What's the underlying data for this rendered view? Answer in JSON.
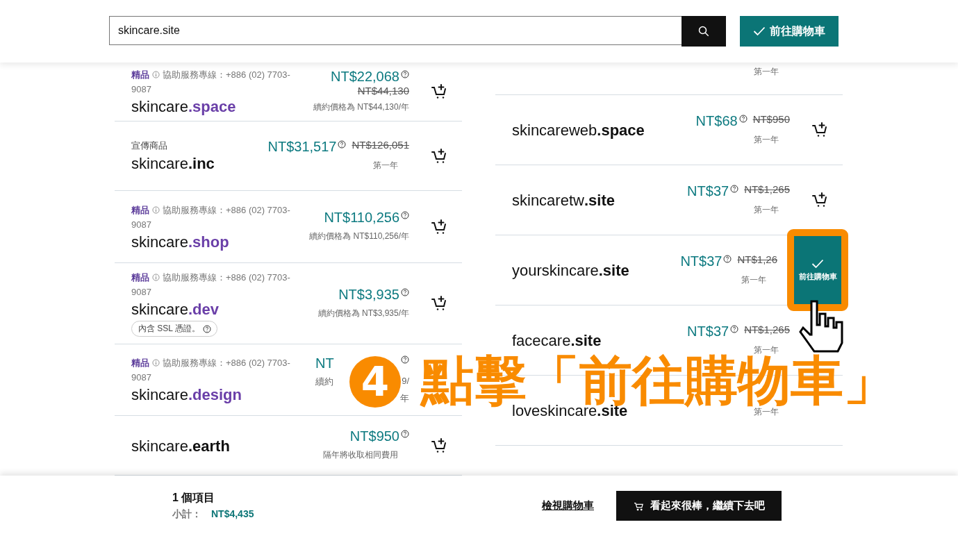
{
  "header": {
    "search": {
      "value": "skincare.site"
    },
    "cart_button": {
      "label": "前往購物車"
    }
  },
  "left_results": [
    {
      "kind": "premium",
      "tag": "精品",
      "hotline": "協助服務專線：+886 (02) 7703-9087",
      "sld": "skincare",
      "tld": ".space",
      "price": "NT$22,068",
      "old_price": "NT$44,130",
      "note": "續約價格為 NT$44,130/年"
    },
    {
      "kind": "promo",
      "tag": "宣傳商品",
      "sld": "skincare",
      "tld": ".inc",
      "price": "NT$31,517",
      "old_price": "NT$126,051",
      "note": "第一年"
    },
    {
      "kind": "premium",
      "tag": "精品",
      "hotline": "協助服務專線：+886 (02) 7703-9087",
      "sld": "skincare",
      "tld": ".shop",
      "price": "NT$110,256",
      "note": "續約價格為 NT$110,256/年"
    },
    {
      "kind": "premium",
      "tag": "精品",
      "hotline": "協助服務專線：+886 (02) 7703-9087",
      "sld": "skincare",
      "tld": ".dev",
      "price": "NT$3,935",
      "note": "續約價格為 NT$3,935/年",
      "badge": "內含 SSL 憑證。"
    },
    {
      "kind": "premium",
      "tag": "精品",
      "hotline": "協助服務專線：+886 (02) 7703-9087",
      "sld": "skincare",
      "tld": ".design",
      "price_parts": {
        "price": "NT",
        "note_left": "續約",
        "note_right": "9/",
        "note_end": "年"
      }
    },
    {
      "kind": "standard",
      "sld": "skincare",
      "tld": ".earth",
      "price": "NT$950",
      "note": "隔年將收取相同費用"
    }
  ],
  "right_results": [
    {
      "kind": "cut",
      "note": "第一年"
    },
    {
      "kind": "standard",
      "sld": "skincareweb",
      "tld": ".space",
      "price": "NT$68",
      "old_price": "NT$950",
      "note": "第一年",
      "in_cart": false
    },
    {
      "kind": "standard",
      "sld": "skincaretw",
      "tld": ".site",
      "price": "NT$37",
      "old_price": "NT$1,265",
      "note": "第一年",
      "in_cart": false
    },
    {
      "kind": "standard",
      "sld": "yourskincare",
      "tld": ".site",
      "price": "NT$37",
      "old_price": "NT$1,26",
      "note": "第一年",
      "in_cart": true,
      "in_cart_label": "前往購物車"
    },
    {
      "kind": "standard",
      "sld": "facecare",
      "tld": ".site",
      "price": "NT$37",
      "old_price": "NT$1,265",
      "note": "第一年"
    },
    {
      "kind": "standard",
      "sld": "loveskincare",
      "tld": ".site",
      "note": "第一年"
    }
  ],
  "footer": {
    "items": "1 個項目",
    "subtotal_label": "小計：",
    "subtotal": "NT$4,435",
    "view_cart": "檢視購物車",
    "continue": "看起來很棒，繼續下去吧"
  },
  "annotation": {
    "step": "4",
    "caption": "點擊「前往購物車」"
  }
}
